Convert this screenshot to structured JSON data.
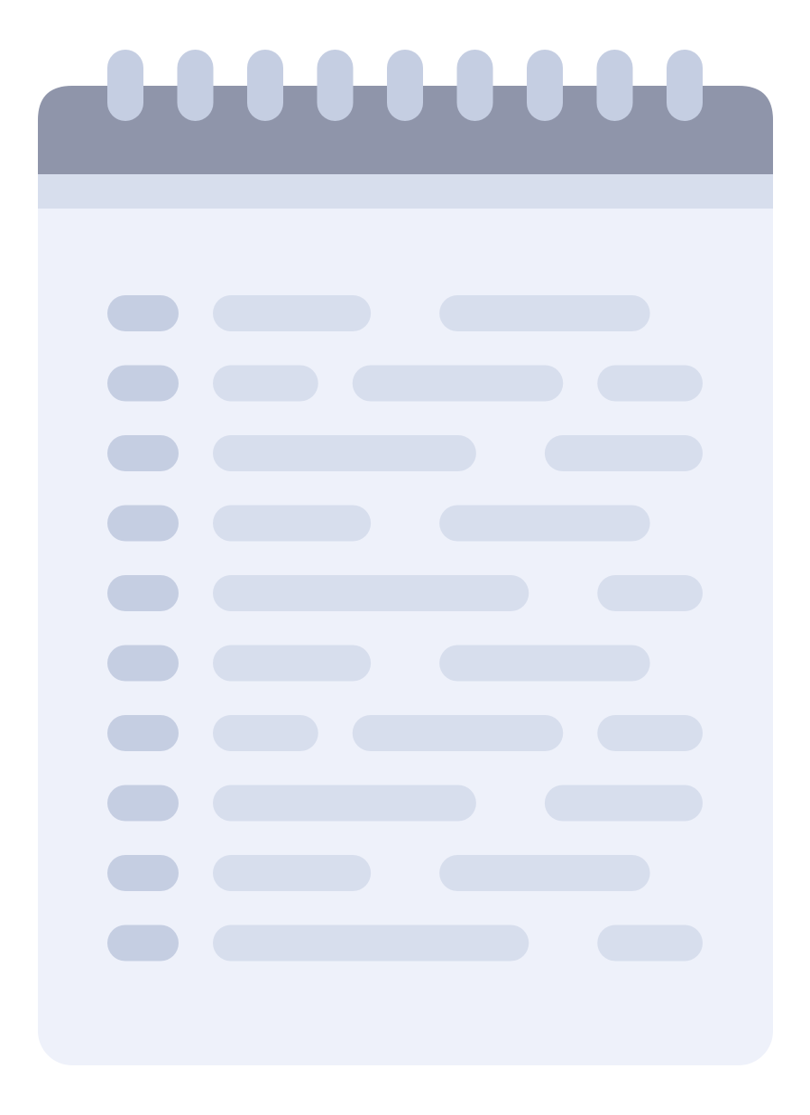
{
  "icon": {
    "name": "notepad-icon",
    "colors": {
      "header": "#8f95aa",
      "header_strip": "#d7deed",
      "paper": "#eef1fa",
      "rings": "#c5cee2",
      "bullet": "#c5cee2",
      "line": "#d7deed"
    },
    "ring_count": 9,
    "rows": [
      {
        "segments": [
          3,
          4
        ]
      },
      {
        "segments": [
          2,
          4,
          2
        ]
      },
      {
        "segments": [
          5,
          3
        ]
      },
      {
        "segments": [
          3,
          4
        ]
      },
      {
        "segments": [
          6,
          2
        ]
      },
      {
        "segments": [
          3,
          4
        ]
      },
      {
        "segments": [
          2,
          4,
          2
        ]
      },
      {
        "segments": [
          5,
          3
        ]
      },
      {
        "segments": [
          3,
          4
        ]
      },
      {
        "segments": [
          6,
          2
        ]
      }
    ]
  }
}
